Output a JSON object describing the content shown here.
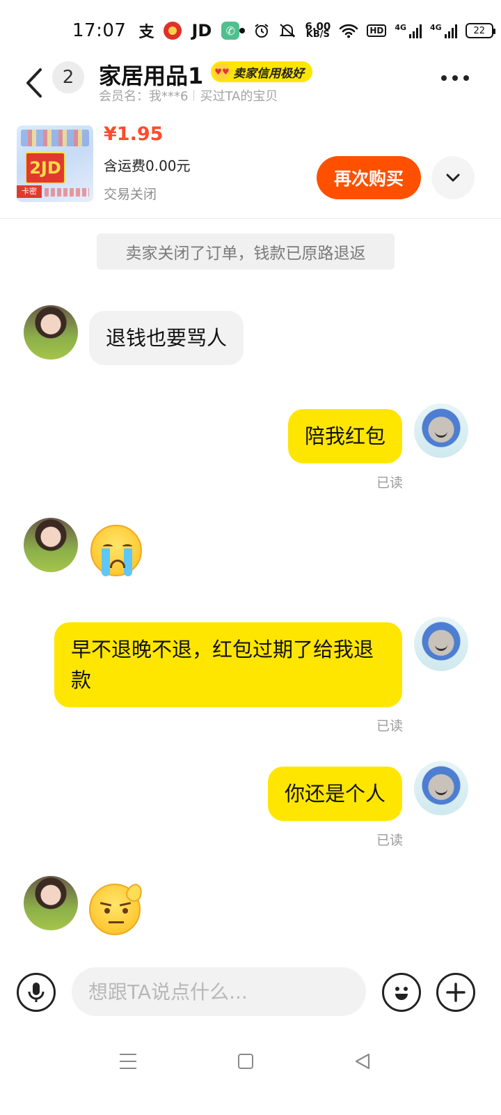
{
  "status_bar": {
    "time": "17:07",
    "speed_value": "6.00",
    "speed_unit": "KB/S",
    "hd": "HD",
    "network_1": "4G",
    "network_2": "4G",
    "battery": "22",
    "jd": "JD",
    "alipay_glyph": "支"
  },
  "header": {
    "unread_count": "2",
    "seller_name": "家居用品1",
    "credit_badge": "卖家信用极好",
    "member_label": "会员名：我***6",
    "bought_label": "买过TA的宝贝"
  },
  "order": {
    "thumb_text": "2JD",
    "thumb_tag": "卡密",
    "price": "¥1.95",
    "shipping": "含运费0.00元",
    "status": "交易关闭",
    "rebuy_label": "再次购买"
  },
  "system_notice": "卖家关闭了订单，钱款已原路退返",
  "messages": [
    {
      "side": "in",
      "type": "text",
      "text": "退钱也要骂人"
    },
    {
      "side": "out",
      "type": "text",
      "text": "陪我红包",
      "read": "已读"
    },
    {
      "side": "in",
      "type": "emoji",
      "icon": "crying-face-emoji"
    },
    {
      "side": "out",
      "type": "text",
      "text": "早不退晚不退，红包过期了给我退款",
      "read": "已读"
    },
    {
      "side": "out",
      "type": "text",
      "text": "你还是个人",
      "read": "已读"
    },
    {
      "side": "in",
      "type": "emoji",
      "icon": "sweating-face-emoji"
    }
  ],
  "input_bar": {
    "placeholder": "想跟TA说点什么..."
  },
  "colors": {
    "accent_yellow": "#ffe600",
    "rebuy_orange": "#ff5000",
    "price_red": "#ff4b2b",
    "incoming_bubble": "#f2f2f2"
  }
}
